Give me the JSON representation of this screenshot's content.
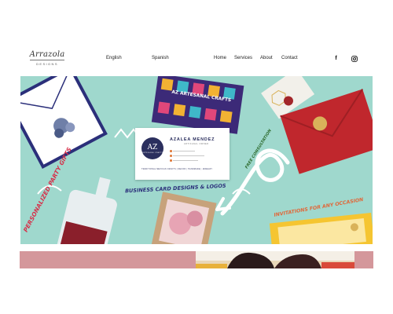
{
  "header": {
    "logo": {
      "script": "Arrazola",
      "sub": "DESIGNS"
    },
    "languages": [
      "English",
      "Spanish"
    ],
    "nav": [
      "Home",
      "Services",
      "About",
      "Contact"
    ],
    "social": [
      {
        "icon": "facebook-icon",
        "glyph": "f"
      },
      {
        "icon": "instagram-icon"
      }
    ]
  },
  "hero": {
    "background_color": "#9fd8cd",
    "texts": {
      "party_gifts": "PERSONALIZED PARTY GIFTS",
      "business_cards": "BUSINESS CARD DESIGNS & LOGOS",
      "free_consultation": "FREE CONSULTATION",
      "invitations": "INVITATIONS FOR ANY OCCASION",
      "artisanal_crafts": "AZ ARTESANAL CRAFTS"
    },
    "business_card": {
      "monogram": "AZ",
      "monogram_sub": "ARTESANAL CRAFTS",
      "name": "AZALEA MENDEZ",
      "title": "ARTISANAL OWNER",
      "footer": "TRADITIONAL MEXICAN CRAFTS | DECOR | HANDMADE | JEWELRY"
    }
  },
  "lower": {
    "left_color": "#d4979b",
    "right_color": "#d4979b"
  }
}
